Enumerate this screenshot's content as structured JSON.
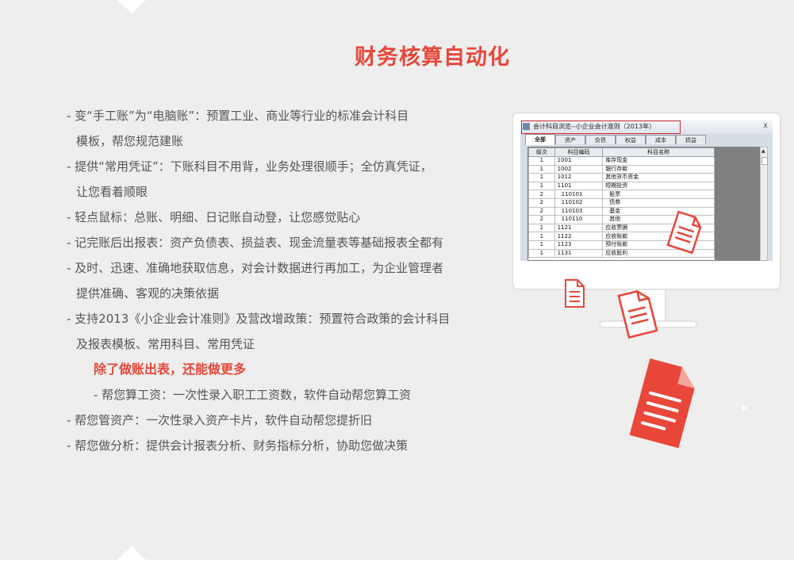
{
  "title": "财务核算自动化",
  "features": [
    {
      "text": "- 变“手工账”为“电脑账”：预置工业、商业等行业的标准会计科目",
      "style": "item"
    },
    {
      "text": "模板，帮您规范建账",
      "style": "cont"
    },
    {
      "text": "- 提供“常用凭证”：下账科目不用背，业务处理很顺手；全仿真凭证，",
      "style": "item"
    },
    {
      "text": "让您看着顺眼",
      "style": "cont"
    },
    {
      "text": "- 轻点鼠标：总账、明细、日记账自动登，让您感觉贴心",
      "style": "item"
    },
    {
      "text": "- 记完账后出报表：资产负债表、损益表、现金流量表等基础报表全都有",
      "style": "item"
    },
    {
      "text": "- 及时、迅速、准确地获取信息，对会计数据进行再加工，为企业管理者",
      "style": "item"
    },
    {
      "text": "提供准确、客观的决策依据",
      "style": "cont"
    },
    {
      "text": "- 支持2013《小企业会计准则》及营改增政策：预置符合政策的会计科目",
      "style": "item"
    },
    {
      "text": "及报表模板、常用科目、常用凭证",
      "style": "cont"
    },
    {
      "text": "除了做账出表，还能做更多",
      "style": "highlight"
    },
    {
      "text": "- 帮您算工资：一次性录入职工工资数，软件自动帮您算工资",
      "style": "sub"
    },
    {
      "text": "- 帮您管资产：一次性录入资产卡片，软件自动帮您提折旧",
      "style": "item"
    },
    {
      "text": "- 帮您做分析：提供会计报表分析、财务指标分析，协助您做决策",
      "style": "item"
    }
  ],
  "window": {
    "title": "会计科目浏览--小企业会计准则（2013年）",
    "close_label": "x",
    "tabs": [
      "全部",
      "资产",
      "负债",
      "权益",
      "成本",
      "损益"
    ],
    "active_tab": 0,
    "columns": [
      "级次",
      "科目编码",
      "科目名称"
    ],
    "rows": [
      [
        "1",
        "1001",
        "库存现金"
      ],
      [
        "1",
        "1002",
        "银行存款"
      ],
      [
        "1",
        "1012",
        "其他货币资金"
      ],
      [
        "1",
        "1101",
        "短期投资"
      ],
      [
        "2",
        "110101",
        "股票"
      ],
      [
        "2",
        "110102",
        "债券"
      ],
      [
        "2",
        "110103",
        "基金"
      ],
      [
        "2",
        "110110",
        "其他"
      ],
      [
        "1",
        "1121",
        "应收票据"
      ],
      [
        "1",
        "1122",
        "应收账款"
      ],
      [
        "1",
        "1123",
        "预付账款"
      ],
      [
        "1",
        "1131",
        "应收股利"
      ]
    ]
  },
  "icons": [
    "document-outline-icon",
    "document-outline-icon",
    "document-outline-icon",
    "document-filled-icon"
  ],
  "colors": {
    "accent": "#e8473a",
    "text": "#555555",
    "panel": "#eeeeee"
  }
}
